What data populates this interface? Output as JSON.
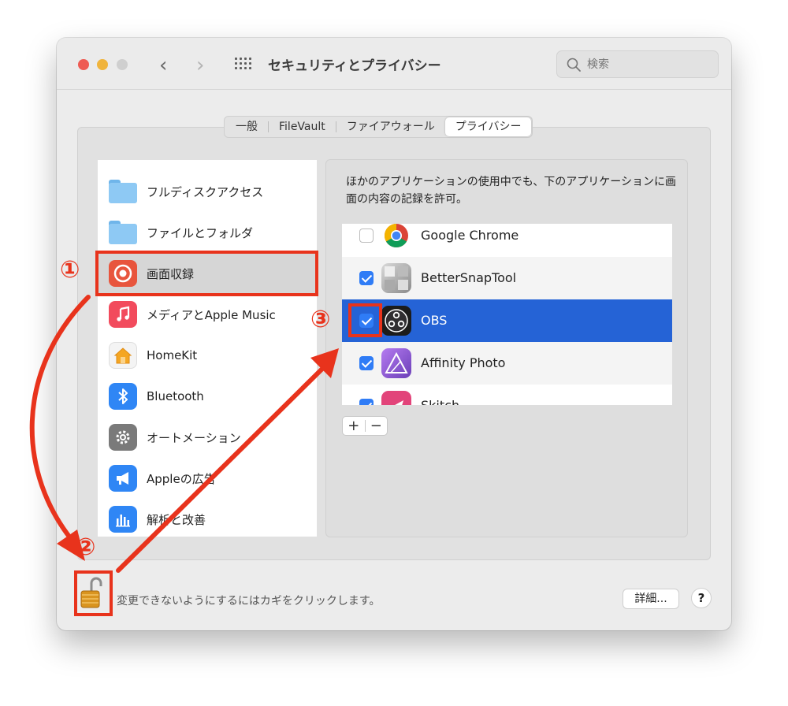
{
  "window": {
    "title": "セキュリティとプライバシー",
    "search_placeholder": "検索",
    "nav_back": "‹",
    "nav_forward": "›"
  },
  "tabs": [
    {
      "label": "一般",
      "active": false
    },
    {
      "label": "FileVault",
      "active": false
    },
    {
      "label": "ファイアウォール",
      "active": false
    },
    {
      "label": "プライバシー",
      "active": true
    }
  ],
  "sidebar": {
    "items": [
      {
        "label": "フルディスクアクセス",
        "icon": "folder-icon"
      },
      {
        "label": "ファイルとフォルダ",
        "icon": "folder-icon"
      },
      {
        "label": "画面収録",
        "icon": "screen-record-icon",
        "selected": true
      },
      {
        "label": "メディアとApple Music",
        "icon": "music-icon"
      },
      {
        "label": "HomeKit",
        "icon": "home-icon"
      },
      {
        "label": "Bluetooth",
        "icon": "bluetooth-icon"
      },
      {
        "label": "オートメーション",
        "icon": "gear-icon"
      },
      {
        "label": "Appleの広告",
        "icon": "megaphone-icon"
      },
      {
        "label": "解析と改善",
        "icon": "chart-icon"
      }
    ]
  },
  "content": {
    "description": "ほかのアプリケーションの使用中でも、下のアプリケーションに画面の内容の記録を許可。",
    "apps": [
      {
        "name": "Google Chrome",
        "checked": false
      },
      {
        "name": "BetterSnapTool",
        "checked": true
      },
      {
        "name": "OBS",
        "checked": true,
        "selected": true
      },
      {
        "name": "Affinity Photo",
        "checked": true
      },
      {
        "name": "Skitch",
        "checked": true
      }
    ],
    "add_label": "+",
    "remove_label": "−"
  },
  "footer": {
    "lock_text": "変更できないようにするにはカギをクリックします。",
    "detail_button": "詳細...",
    "help_button": "?"
  },
  "annotations": {
    "step1": "①",
    "step2": "②",
    "step3": "③",
    "color": "#e8331c"
  },
  "colors": {
    "selection_blue": "#2563d6",
    "checkbox_blue": "#2f7cf6",
    "traffic_red": "#ee5b53",
    "traffic_yellow": "#f0b43c"
  }
}
